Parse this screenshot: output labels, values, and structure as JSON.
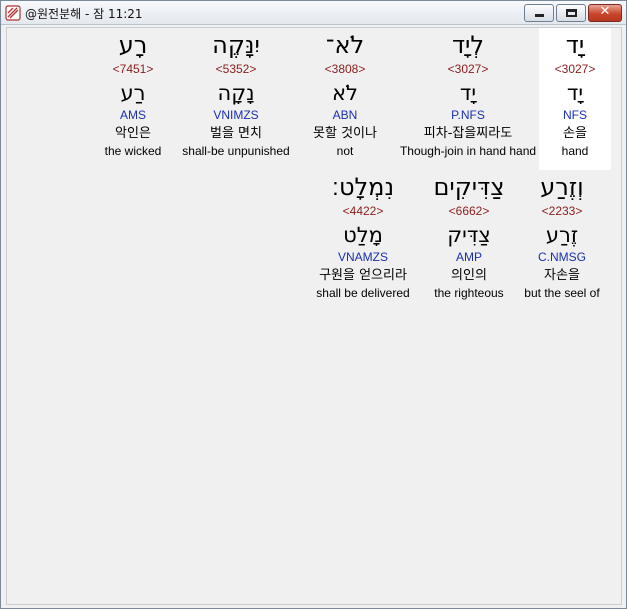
{
  "window": {
    "title": "@원전분해 - 잠 11:21",
    "buttons": {
      "minimize": "minimize",
      "maximize": "maximize",
      "close": "✕"
    }
  },
  "rows": [
    {
      "words": [
        {
          "hebrew": "יָד",
          "strong": "<3027>",
          "lemma": "יָד",
          "morph": "NFS",
          "korean": "손을",
          "english": "hand",
          "selected": true
        },
        {
          "hebrew": "לְיָד",
          "strong": "<3027>",
          "lemma": "יָד",
          "morph": "P.NFS",
          "korean": "피차-잡을찌라도",
          "english": "Though-join in hand hand",
          "selected": false
        },
        {
          "hebrew": "לֹא־",
          "strong": "<3808>",
          "lemma": "לֹא",
          "morph": "ABN",
          "korean": "못할 것이나",
          "english": "not",
          "selected": false
        },
        {
          "hebrew": "יִנָּקֶה",
          "strong": "<5352>",
          "lemma": "נָקָה",
          "morph": "VNIMZS",
          "korean": "벌을 면치",
          "english": "shall-be unpunished",
          "selected": false
        },
        {
          "hebrew": "רָע",
          "strong": "<7451>",
          "lemma": "רַע",
          "morph": "AMS",
          "korean": "악인은",
          "english": "the wicked",
          "selected": false
        }
      ]
    },
    {
      "words": [
        {
          "hebrew": "וְזֶרַע",
          "strong": "<2233>",
          "lemma": "זֶרַע",
          "morph": "C.NMSG",
          "korean": "자손을",
          "english": "but the seel of",
          "selected": false
        },
        {
          "hebrew": "צַדִּיקִים",
          "strong": "<6662>",
          "lemma": "צַדִּיק",
          "morph": "AMP",
          "korean": "의인의",
          "english": "the righteous",
          "selected": false
        },
        {
          "hebrew": "נִמְלָט׃",
          "strong": "<4422>",
          "lemma": "מָלַט",
          "morph": "VNAMZS",
          "korean": "구원을 얻으리라",
          "english": "shall be delivered",
          "selected": false
        }
      ]
    }
  ]
}
